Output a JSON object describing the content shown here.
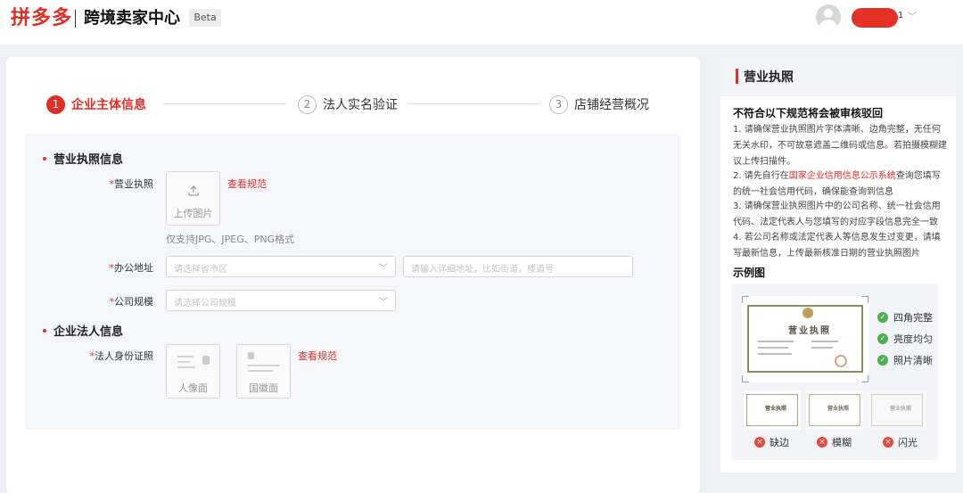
{
  "header": {
    "brand": "拼多多",
    "center_name": "跨境卖家中心",
    "beta": "Beta",
    "user_suffix": "1"
  },
  "steps": [
    {
      "num": "1",
      "label": "企业主体信息",
      "active": true
    },
    {
      "num": "2",
      "label": "法人实名验证",
      "active": false
    },
    {
      "num": "3",
      "label": "店铺经营概况",
      "active": false
    }
  ],
  "form": {
    "license_section": "营业执照信息",
    "license_label": "营业执照",
    "upload_text": "上传图片",
    "view_rule": "查看规范",
    "format_hint": "仅支持JPG、JPEG、PNG格式",
    "address_label": "办公地址",
    "address_placeholder": "请选择省市区",
    "address_detail_placeholder": "请输入详细地址，比如街道，楼道号",
    "scale_label": "公司规模",
    "scale_placeholder": "请选择公司规模",
    "legal_section": "企业法人信息",
    "id_label": "法人身份证照",
    "id_front": "人像面",
    "id_back": "国徽面",
    "id_view_rule": "查看规范",
    "required_mark": "*"
  },
  "side": {
    "title": "营业执照",
    "warn_title": "不符合以下规范将会被审核驳回",
    "rule1": "1. 请确保营业执照图片字体清晰、边角完整，无任何无关水印，不可故意遮盖二维码或信息。若拍摄模糊建议上传扫描件。",
    "rule2_pre": "2. 请先自行在",
    "rule2_link": "国家企业信用信息公示系统",
    "rule2_post": "查询您填写的统一社会信用代码，确保能查询到信息",
    "rule3": "3. 请确保营业执照图片中的公司名称、统一社会信用代码、法定代表人与您填写的对应字段信息完全一致",
    "rule4": "4. 若公司名称或法定代表人等信息发生过变更，请填写最新信息，上传最新核准日期的营业执照图片",
    "example_title": "示例图",
    "license_heading": "营业执照",
    "good": [
      "四角完整",
      "亮度均匀",
      "照片清晰"
    ],
    "bad": [
      "缺边",
      "模糊",
      "闪光"
    ]
  },
  "colors": {
    "accent": "#e02e24",
    "success": "#4caf50",
    "error": "#e64a3c"
  }
}
